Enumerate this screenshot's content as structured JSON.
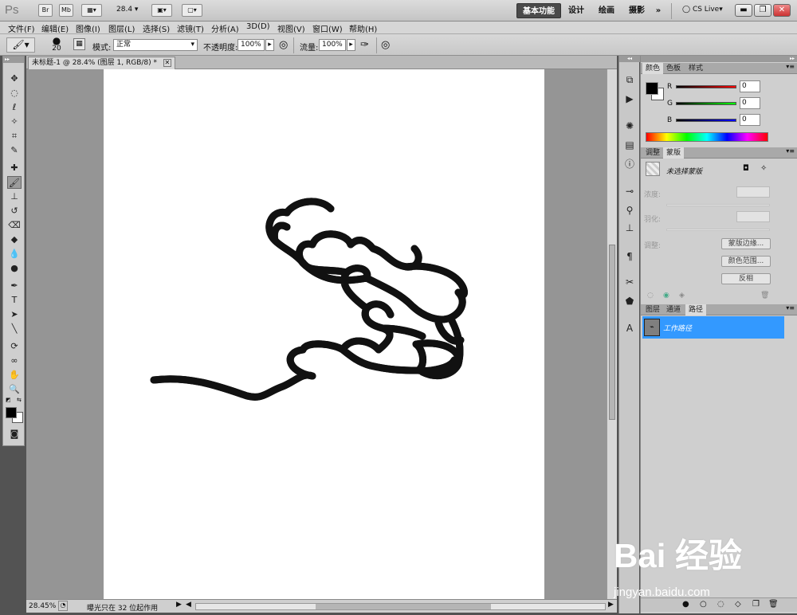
{
  "app": {
    "logo": "Ps",
    "bridge_label": "Br",
    "minibridge_label": "Mb",
    "zoom": "28.4",
    "workspaces": [
      "基本功能",
      "设计",
      "绘画",
      "摄影"
    ],
    "more": "»",
    "cslive": "CS Live"
  },
  "menu": [
    "文件(F)",
    "编辑(E)",
    "图像(I)",
    "图层(L)",
    "选择(S)",
    "滤镜(T)",
    "分析(A)",
    "3D(D)",
    "视图(V)",
    "窗口(W)",
    "帮助(H)"
  ],
  "options": {
    "brush_size": "20",
    "mode_label": "模式:",
    "mode_value": "正常",
    "opacity_label": "不透明度:",
    "opacity_value": "100%",
    "flow_label": "流量:",
    "flow_value": "100%"
  },
  "document": {
    "tab_title": "未标题-1 @ 28.4% (图层 1, RGB/8) *",
    "zoom_status": "28.45%",
    "status_text": "曝光只在 32 位起作用"
  },
  "color_panel": {
    "tabs": [
      "颜色",
      "色板",
      "样式"
    ],
    "channels": [
      {
        "label": "R",
        "value": "0",
        "color": "#cc0000"
      },
      {
        "label": "G",
        "value": "0",
        "color": "#00aa00"
      },
      {
        "label": "B",
        "value": "0",
        "color": "#0000cc"
      }
    ]
  },
  "masks_panel": {
    "tabs": [
      "调整",
      "蒙版"
    ],
    "title": "未选择蒙版",
    "density_label": "浓度:",
    "feather_label": "羽化:",
    "refine_label": "调整:",
    "mask_edge_button": "蒙版边缘...",
    "color_range_button": "颜色范围...",
    "invert_button": "反相"
  },
  "layers_panel": {
    "tabs": [
      "图层",
      "通道",
      "路径"
    ],
    "path_name": "工作路径"
  },
  "watermark": {
    "brand": "Bai 经验",
    "url": "jingyan.baidu.com"
  },
  "colors": {
    "selection": "#3399ff",
    "foreground": "#000000",
    "background": "#ffffff"
  }
}
